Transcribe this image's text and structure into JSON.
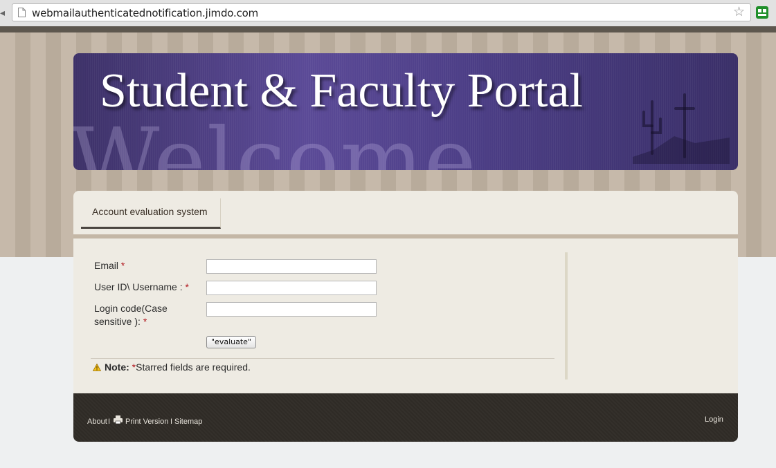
{
  "browser": {
    "url": "webmailauthenticatednotification.jimdo.com"
  },
  "banner": {
    "title": "Student & Faculty Portal",
    "background_word": "Welcome"
  },
  "nav": {
    "tabs": [
      {
        "label": "Account evaluation system"
      }
    ]
  },
  "form": {
    "email_label": "Email",
    "username_label": "User ID\\ Username :",
    "logincode_label_line1": "Login code(Case",
    "logincode_label_line2": "sensitive ):",
    "required_marker": "*",
    "email_value": "",
    "username_value": "",
    "logincode_value": "",
    "submit_label": "\"evaluate\"",
    "note_bold": "Note:",
    "note_marker": "*",
    "note_text": "Starred fields are required."
  },
  "footer": {
    "about": "About",
    "sep1": "I",
    "print": "Print Version",
    "sep2": "I",
    "sitemap": "Sitemap",
    "login": "Login"
  },
  "colors": {
    "banner": "#4c3e86",
    "required": "#b0141b",
    "footer": "#2f2b26",
    "content_bg": "#eeebe3"
  }
}
